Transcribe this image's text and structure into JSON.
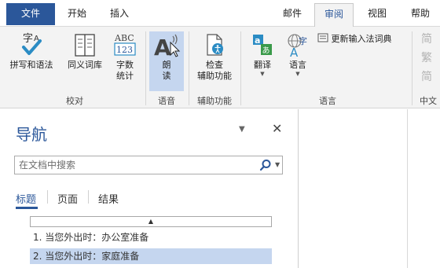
{
  "tabs": {
    "file": "文件",
    "home": "开始",
    "insert": "插入",
    "mailings": "邮件",
    "review": "审阅",
    "view": "视图",
    "help": "帮助"
  },
  "ribbon": {
    "proofing": {
      "spelling": "拼写和语法",
      "thesaurus": "同义词库",
      "word_count_1": "字数",
      "word_count_2": "统计",
      "group": "校对"
    },
    "speech": {
      "read_aloud_1": "朗",
      "read_aloud_2": "读",
      "group": "语音"
    },
    "accessibility": {
      "check_1": "检查",
      "check_2": "辅助功能",
      "group": "辅助功能"
    },
    "language": {
      "translate": "翻译",
      "language": "语言",
      "update_ime": "更新输入法词典",
      "group": "语言"
    },
    "chinese": {
      "btn1": "简",
      "btn2": "繁",
      "btn3": "简",
      "group": "中文"
    }
  },
  "nav_pane": {
    "title": "导航",
    "search_placeholder": "在文档中搜索",
    "tabs": [
      "标题",
      "页面",
      "结果"
    ],
    "headings": [
      "1. 当您外出时：办公室准备",
      "2. 当您外出时：家庭准备"
    ]
  },
  "colors": {
    "accent": "#2b579a",
    "selected": "#c5d6ef",
    "ribbon_bg": "#f3f3f3"
  }
}
